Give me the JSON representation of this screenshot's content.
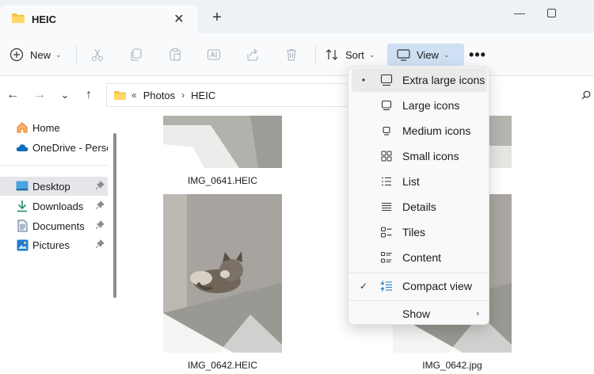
{
  "tab": {
    "title": "HEIC",
    "close_glyph": "✕",
    "new_tab_glyph": "+"
  },
  "window_controls": {
    "minimize": "—",
    "maximize": "☐"
  },
  "commandbar": {
    "new_label": "New",
    "sort_label": "Sort",
    "view_label": "View",
    "more_glyph": "•••",
    "chevron": "⌄"
  },
  "address": {
    "overflow": "«",
    "crumbs": [
      "Photos",
      "HEIC"
    ],
    "separator": "›"
  },
  "nav": {
    "back": "←",
    "forward": "→",
    "recent": "⌄",
    "up": "↑"
  },
  "sidebar": {
    "items": [
      {
        "label": "Home",
        "icon": "home-icon"
      },
      {
        "label": "OneDrive - Persor",
        "icon": "cloud-icon"
      },
      {
        "label": "Desktop",
        "icon": "desktop-icon",
        "pinned": true,
        "selected": true
      },
      {
        "label": "Downloads",
        "icon": "download-icon",
        "pinned": true
      },
      {
        "label": "Documents",
        "icon": "document-icon",
        "pinned": true
      },
      {
        "label": "Pictures",
        "icon": "picture-icon",
        "pinned": true
      }
    ]
  },
  "files": [
    {
      "name": "IMG_0641.HEIC"
    },
    {
      "name": "IMG_0642.HEIC"
    },
    {
      "name": "IMG_0642.jpg"
    }
  ],
  "view_menu": {
    "items": [
      {
        "label": "Extra large icons",
        "icon": "extra-large-icons-icon",
        "mark": "•"
      },
      {
        "label": "Large icons",
        "icon": "large-icons-icon",
        "mark": ""
      },
      {
        "label": "Medium icons",
        "icon": "medium-icons-icon",
        "mark": ""
      },
      {
        "label": "Small icons",
        "icon": "small-icons-icon",
        "mark": ""
      },
      {
        "label": "List",
        "icon": "list-icon",
        "mark": ""
      },
      {
        "label": "Details",
        "icon": "details-icon",
        "mark": ""
      },
      {
        "label": "Tiles",
        "icon": "tiles-icon",
        "mark": ""
      },
      {
        "label": "Content",
        "icon": "content-icon",
        "mark": ""
      }
    ],
    "compact_view": {
      "label": "Compact view",
      "mark": "✓"
    },
    "show": {
      "label": "Show",
      "submenu_glyph": "›"
    }
  },
  "colors": {
    "accent": "#0067c0",
    "view_button_bg": "#cfe0f5",
    "folder": "#f4c14e"
  }
}
